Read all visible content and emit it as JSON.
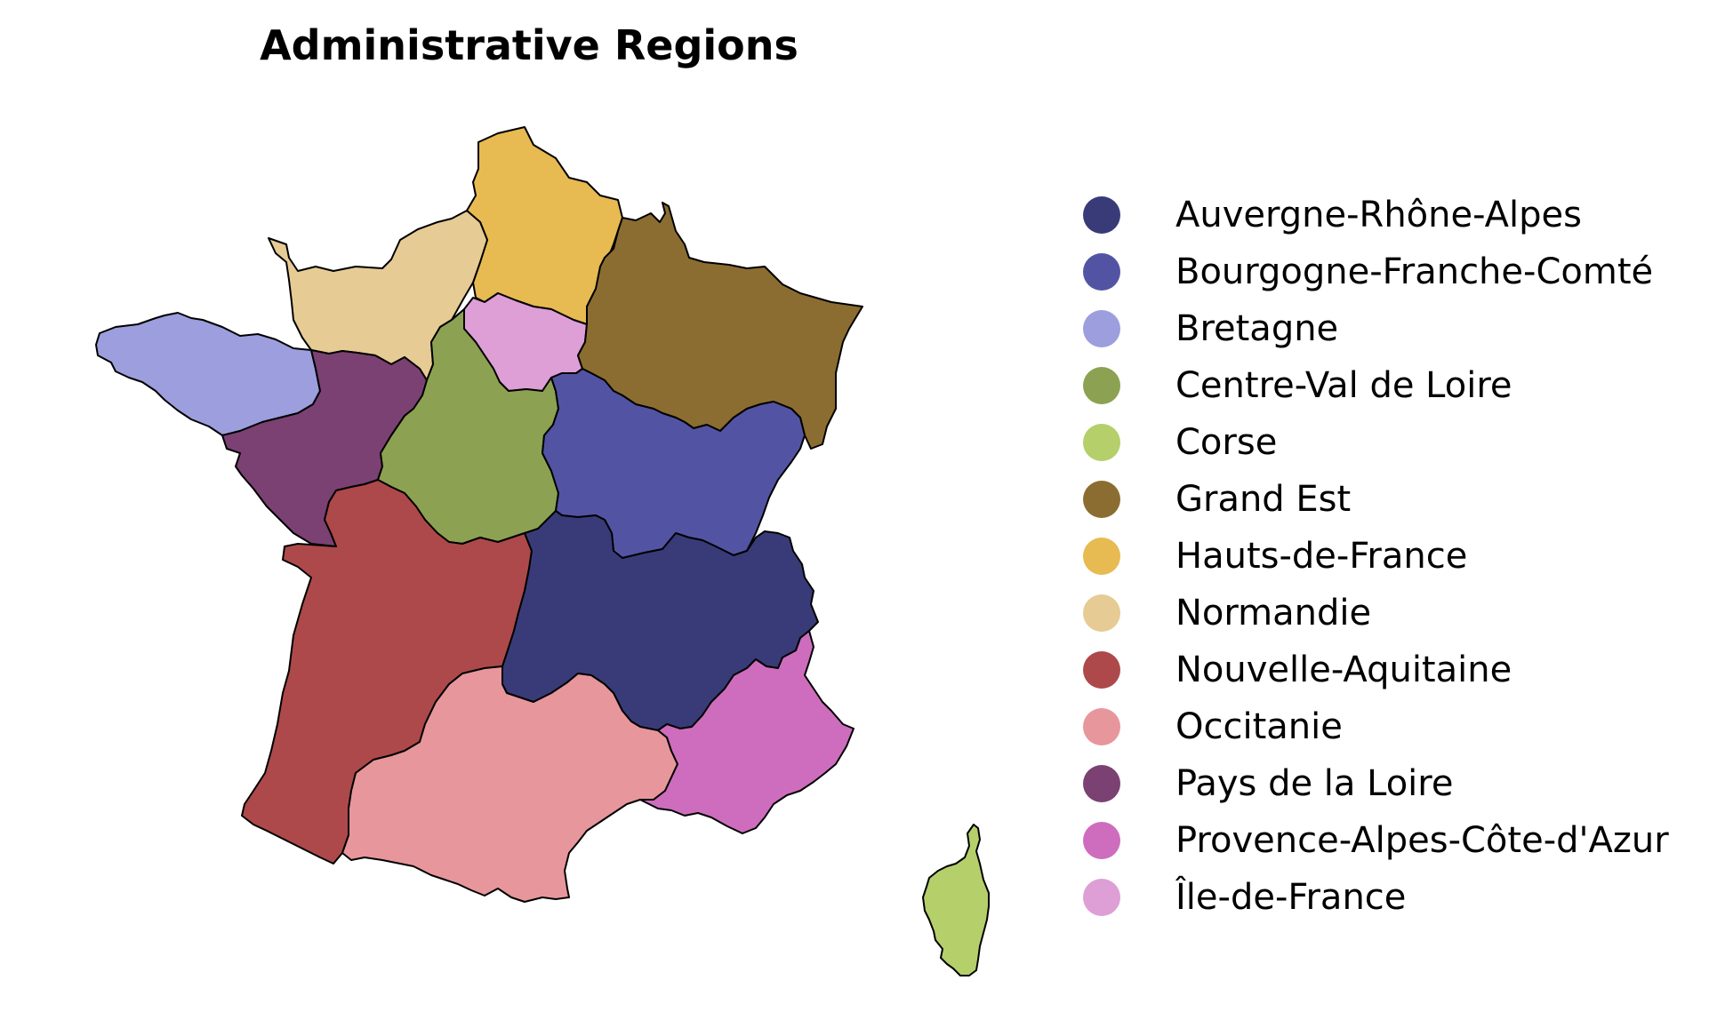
{
  "title": "Administrative Regions",
  "regions": [
    {
      "key": "auvergne-rhone-alpes",
      "name": "Auvergne-Rhône-Alpes",
      "color": "#393b79"
    },
    {
      "key": "bourgogne-franche-comte",
      "name": "Bourgogne-Franche-Comté",
      "color": "#5254a3"
    },
    {
      "key": "bretagne",
      "name": "Bretagne",
      "color": "#9c9ede"
    },
    {
      "key": "centre-val-de-loire",
      "name": "Centre-Val de Loire",
      "color": "#8ca252"
    },
    {
      "key": "corse",
      "name": "Corse",
      "color": "#b5cf6b"
    },
    {
      "key": "grand-est",
      "name": "Grand Est",
      "color": "#8c6d31"
    },
    {
      "key": "hauts-de-france",
      "name": "Hauts-de-France",
      "color": "#e7ba52"
    },
    {
      "key": "normandie",
      "name": "Normandie",
      "color": "#e7cb94"
    },
    {
      "key": "nouvelle-aquitaine",
      "name": "Nouvelle-Aquitaine",
      "color": "#ad494a"
    },
    {
      "key": "occitanie",
      "name": "Occitanie",
      "color": "#e7969c"
    },
    {
      "key": "pays-de-la-loire",
      "name": "Pays de la Loire",
      "color": "#7b4173"
    },
    {
      "key": "provence-alpes-cote-dazur",
      "name": "Provence-Alpes-Côte-d'Azur",
      "color": "#ce6dbd"
    },
    {
      "key": "ile-de-france",
      "name": "Île-de-France",
      "color": "#de9ed6"
    }
  ]
}
